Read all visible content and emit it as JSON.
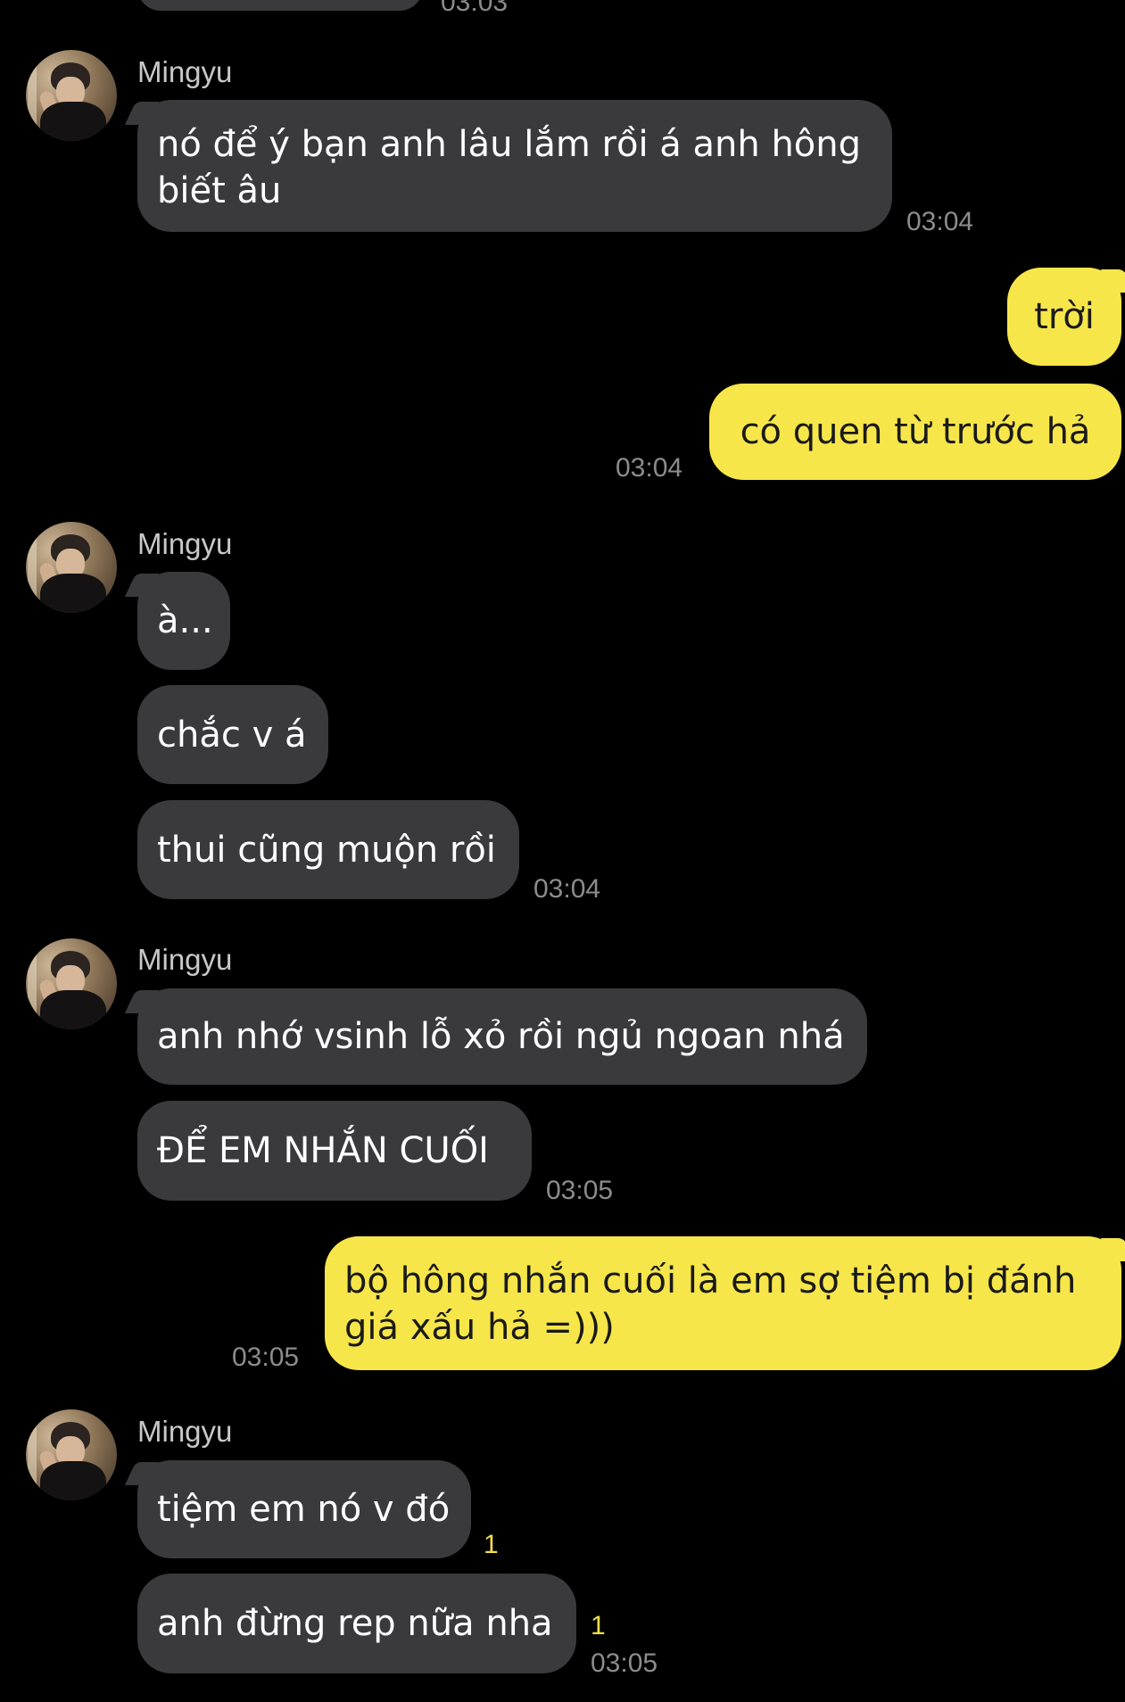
{
  "colors": {
    "background": "#000000",
    "incoming_bubble": "#3a3a3c",
    "outgoing_bubble": "#f7e64a",
    "timestamp": "#8c8c8c",
    "unread_count": "#f3de4c"
  },
  "conversation": {
    "top_clipped_time": "03:03",
    "groups": [
      {
        "sender": "Mingyu",
        "avatar_icon": "profile-photo-avatar",
        "messages": [
          "nó để ý bạn anh lâu lắm rồi á anh hông biết âu"
        ],
        "time": "03:04"
      },
      {
        "outgoing": true,
        "messages": [
          "trời",
          "có quen từ trước hả"
        ],
        "time": "03:04"
      },
      {
        "sender": "Mingyu",
        "avatar_icon": "profile-photo-avatar",
        "messages": [
          "à...",
          "chắc v á",
          "thui cũng muộn rồi"
        ],
        "time": "03:04"
      },
      {
        "sender": "Mingyu",
        "avatar_icon": "profile-photo-avatar",
        "messages": [
          "anh nhớ vsinh lỗ xỏ rồi ngủ ngoan nhá",
          "ĐỂ EM NHẮN CUỐI"
        ],
        "time": "03:05"
      },
      {
        "outgoing": true,
        "messages": [
          "bộ hông nhắn cuối là em sợ tiệm bị đánh giá xấu hả =)))"
        ],
        "time": "03:05"
      },
      {
        "sender": "Mingyu",
        "avatar_icon": "profile-photo-avatar",
        "messages": [
          "tiệm em nó v đó",
          "anh đừng rep nữa nha"
        ],
        "unread": [
          "1",
          "1"
        ],
        "time": "03:05"
      }
    ]
  }
}
